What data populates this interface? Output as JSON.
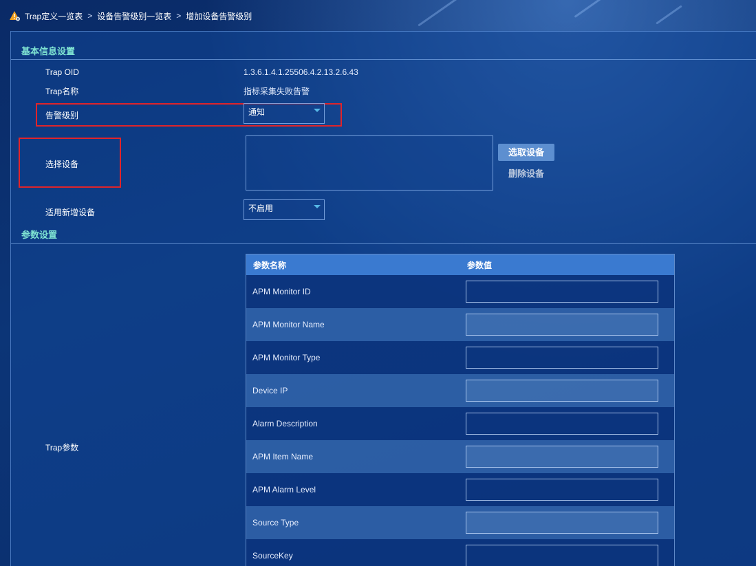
{
  "breadcrumb": {
    "items": [
      "Trap定义一览表",
      "设备告警级别一览表",
      "增加设备告警级别"
    ],
    "separator": ">"
  },
  "basic": {
    "section_title": "基本信息设置",
    "trap_oid_label": "Trap OID",
    "trap_oid_value": "1.3.6.1.4.1.25506.4.2.13.2.6.43",
    "trap_name_label": "Trap名称",
    "trap_name_value": "指标采集失败告警",
    "alarm_level_label": "告警级别",
    "alarm_level_value": "通知",
    "select_device_label": "选择设备",
    "pick_device_button": "选取设备",
    "delete_device_button": "删除设备",
    "apply_new_label": "适用新增设备",
    "apply_new_value": "不启用"
  },
  "params": {
    "section_title": "参数设置",
    "trap_params_label": "Trap参数",
    "columns": [
      "参数名称",
      "参数值"
    ],
    "rows": [
      "APM Monitor ID",
      "APM Monitor Name",
      "APM Monitor Type",
      "Device IP",
      "Alarm Description",
      "APM Item Name",
      "APM Alarm Level",
      "Source Type",
      "SourceKey"
    ]
  },
  "colors": {
    "section_title": "#7fe3d2",
    "highlight_border": "#e0242a",
    "table_header": "#3a7ad0",
    "primary_button": "#5d8fd0"
  },
  "icons": {
    "breadcrumb": "warning-gear-icon",
    "select_caret": "caret-down-icon"
  }
}
